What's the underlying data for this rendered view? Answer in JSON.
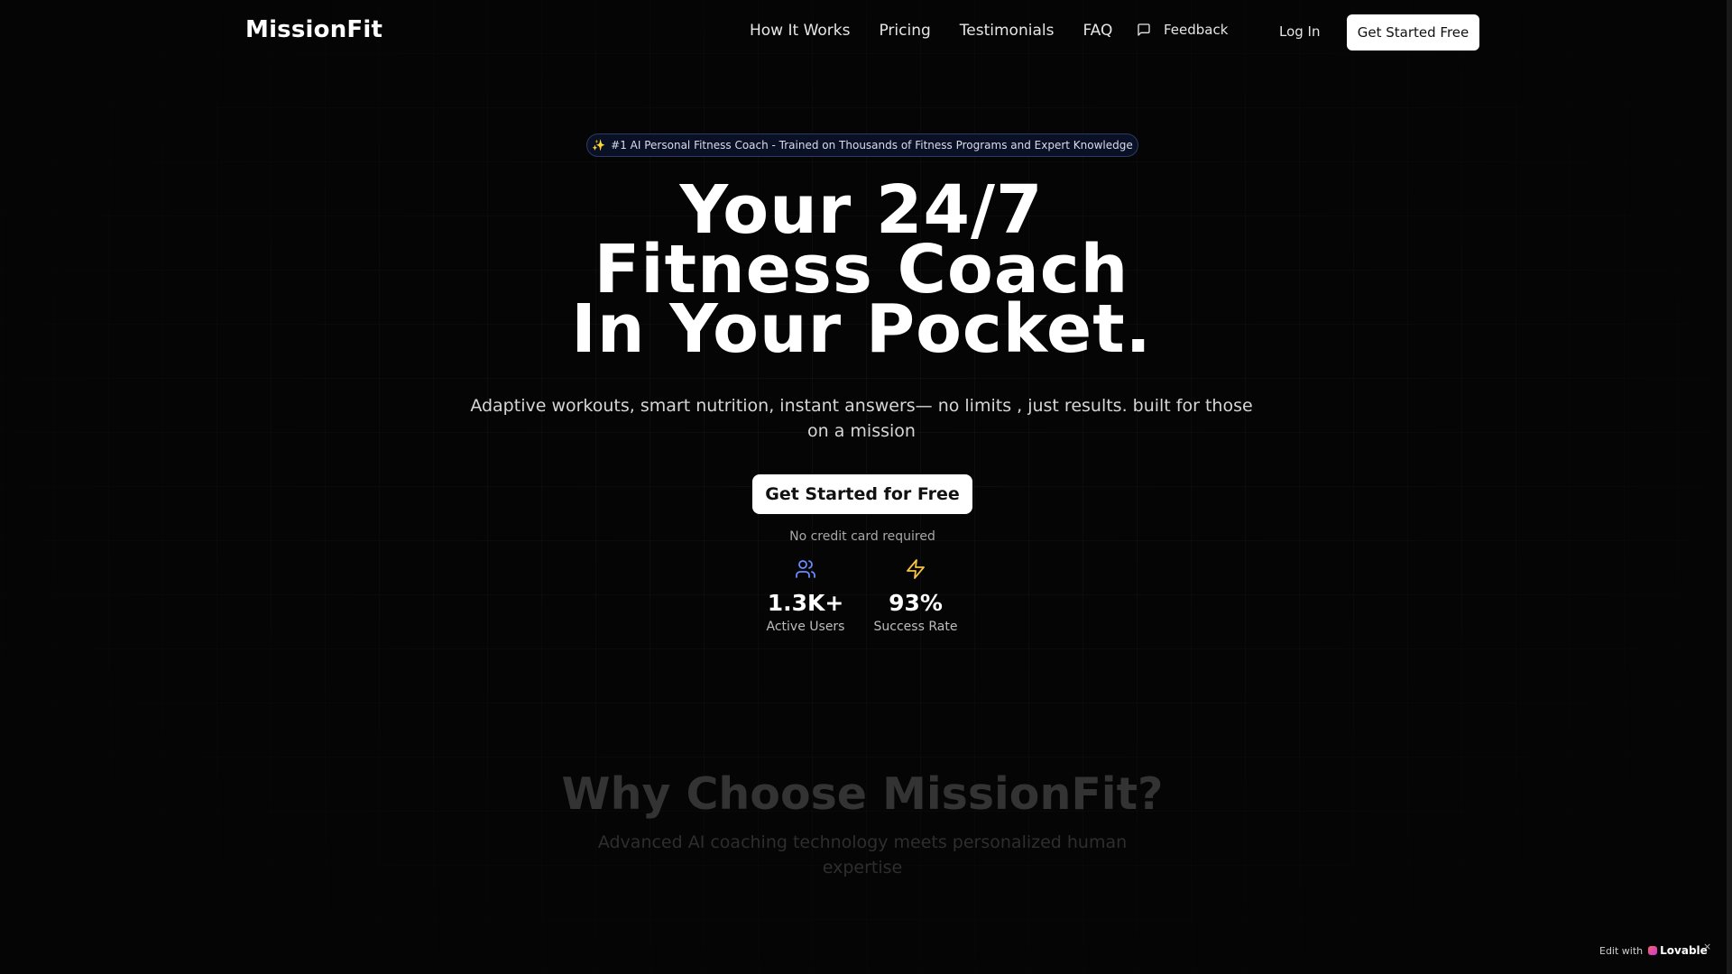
{
  "nav": {
    "logo": "MissionFit",
    "links": [
      "How It Works",
      "Pricing",
      "Testimonials",
      "FAQ"
    ],
    "feedback": "Feedback",
    "login": "Log In",
    "cta": "Get Started Free"
  },
  "hero": {
    "badge": "#1 AI Personal Fitness Coach - Trained on Thousands of Fitness Programs and Expert Knowledge",
    "headline": [
      "Your 24/7",
      "Fitness Coach",
      "In Your Pocket."
    ],
    "subtitle": "Adaptive workouts, smart nutrition, instant answers— no limits , just results. built for those on a mission",
    "cta": "Get Started for Free",
    "note": "No credit card required",
    "stats": [
      {
        "value": "1.3K+",
        "label": "Active Users",
        "icon": "users-icon",
        "color": "#6b8cff"
      },
      {
        "value": "93%",
        "label": "Success Rate",
        "icon": "lightning-icon",
        "color": "#f5c542"
      }
    ]
  },
  "why": {
    "title": "Why Choose MissionFit?",
    "subtitle": "Advanced AI coaching technology meets personalized human expertise"
  },
  "footer_badge": {
    "prefix": "Edit with",
    "brand": "Lovable",
    "close": "×"
  }
}
